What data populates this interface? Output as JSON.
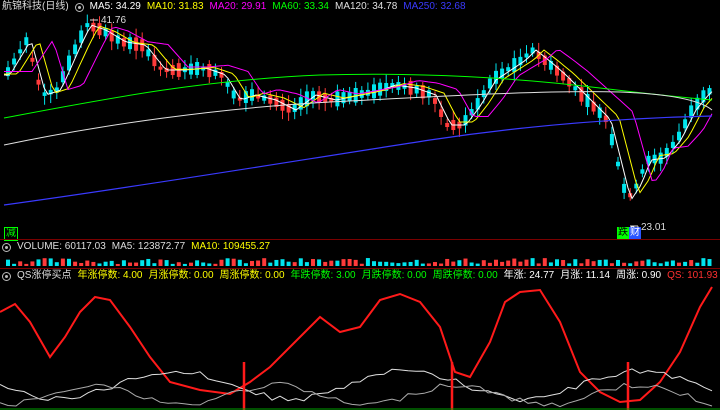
{
  "main_panel": {
    "stock_title": "航锦科技(日线)",
    "indicators": [
      {
        "label": "MA5: 34.29",
        "color": "#ffffff"
      },
      {
        "label": "MA10: 31.83",
        "color": "#ffff00"
      },
      {
        "label": "MA20: 29.91",
        "color": "#ff00ff"
      },
      {
        "label": "MA60: 33.34",
        "color": "#00ff00"
      },
      {
        "label": "MA120: 34.78",
        "color": "#e0e0e0"
      },
      {
        "label": "MA250: 32.68",
        "color": "#3a3aff"
      }
    ],
    "high_marker": "41.76",
    "low_marker": "23.01",
    "badge_jian": "减",
    "badge_die": "跌",
    "badge_cai": "财"
  },
  "volume_panel": {
    "labels": [
      {
        "label": "VOLUME: 60117.03",
        "color": "#dddddd"
      },
      {
        "label": "MA5: 123872.77",
        "color": "#dddddd"
      },
      {
        "label": "MA10: 109455.27",
        "color": "#ffff00"
      }
    ]
  },
  "indicator_panel": {
    "labels": [
      {
        "label": "QS涨停买点",
        "color": "#dddddd"
      },
      {
        "label": "年涨停数: 4.00",
        "color": "#ffff00"
      },
      {
        "label": "月涨停数: 0.00",
        "color": "#ffff00"
      },
      {
        "label": "周涨停数: 0.00",
        "color": "#ffff00"
      },
      {
        "label": "年跌停数: 3.00",
        "color": "#00ff00"
      },
      {
        "label": "月跌停数: 0.00",
        "color": "#00ff00"
      },
      {
        "label": "周跌停数: 0.00",
        "color": "#00ff00"
      },
      {
        "label": "年涨: 24.77",
        "color": "#ffffff"
      },
      {
        "label": "月涨: 11.14",
        "color": "#ffffff"
      },
      {
        "label": "周涨: 0.90",
        "color": "#ffffff"
      },
      {
        "label": "QS: 101.93",
        "color": "#ff3030"
      }
    ]
  },
  "colors": {
    "up": "#00e5ee",
    "down": "#ff3a3a",
    "ma5": "#ffffff",
    "ma10": "#ffff00",
    "ma20": "#ff00ff",
    "ma60": "#00ff00",
    "ma120": "#e0e0e0",
    "ma250": "#3a3aff",
    "qs": "#ff1a1a",
    "aux": "#e0e0e0",
    "aux2": "#aaaaaa"
  }
}
